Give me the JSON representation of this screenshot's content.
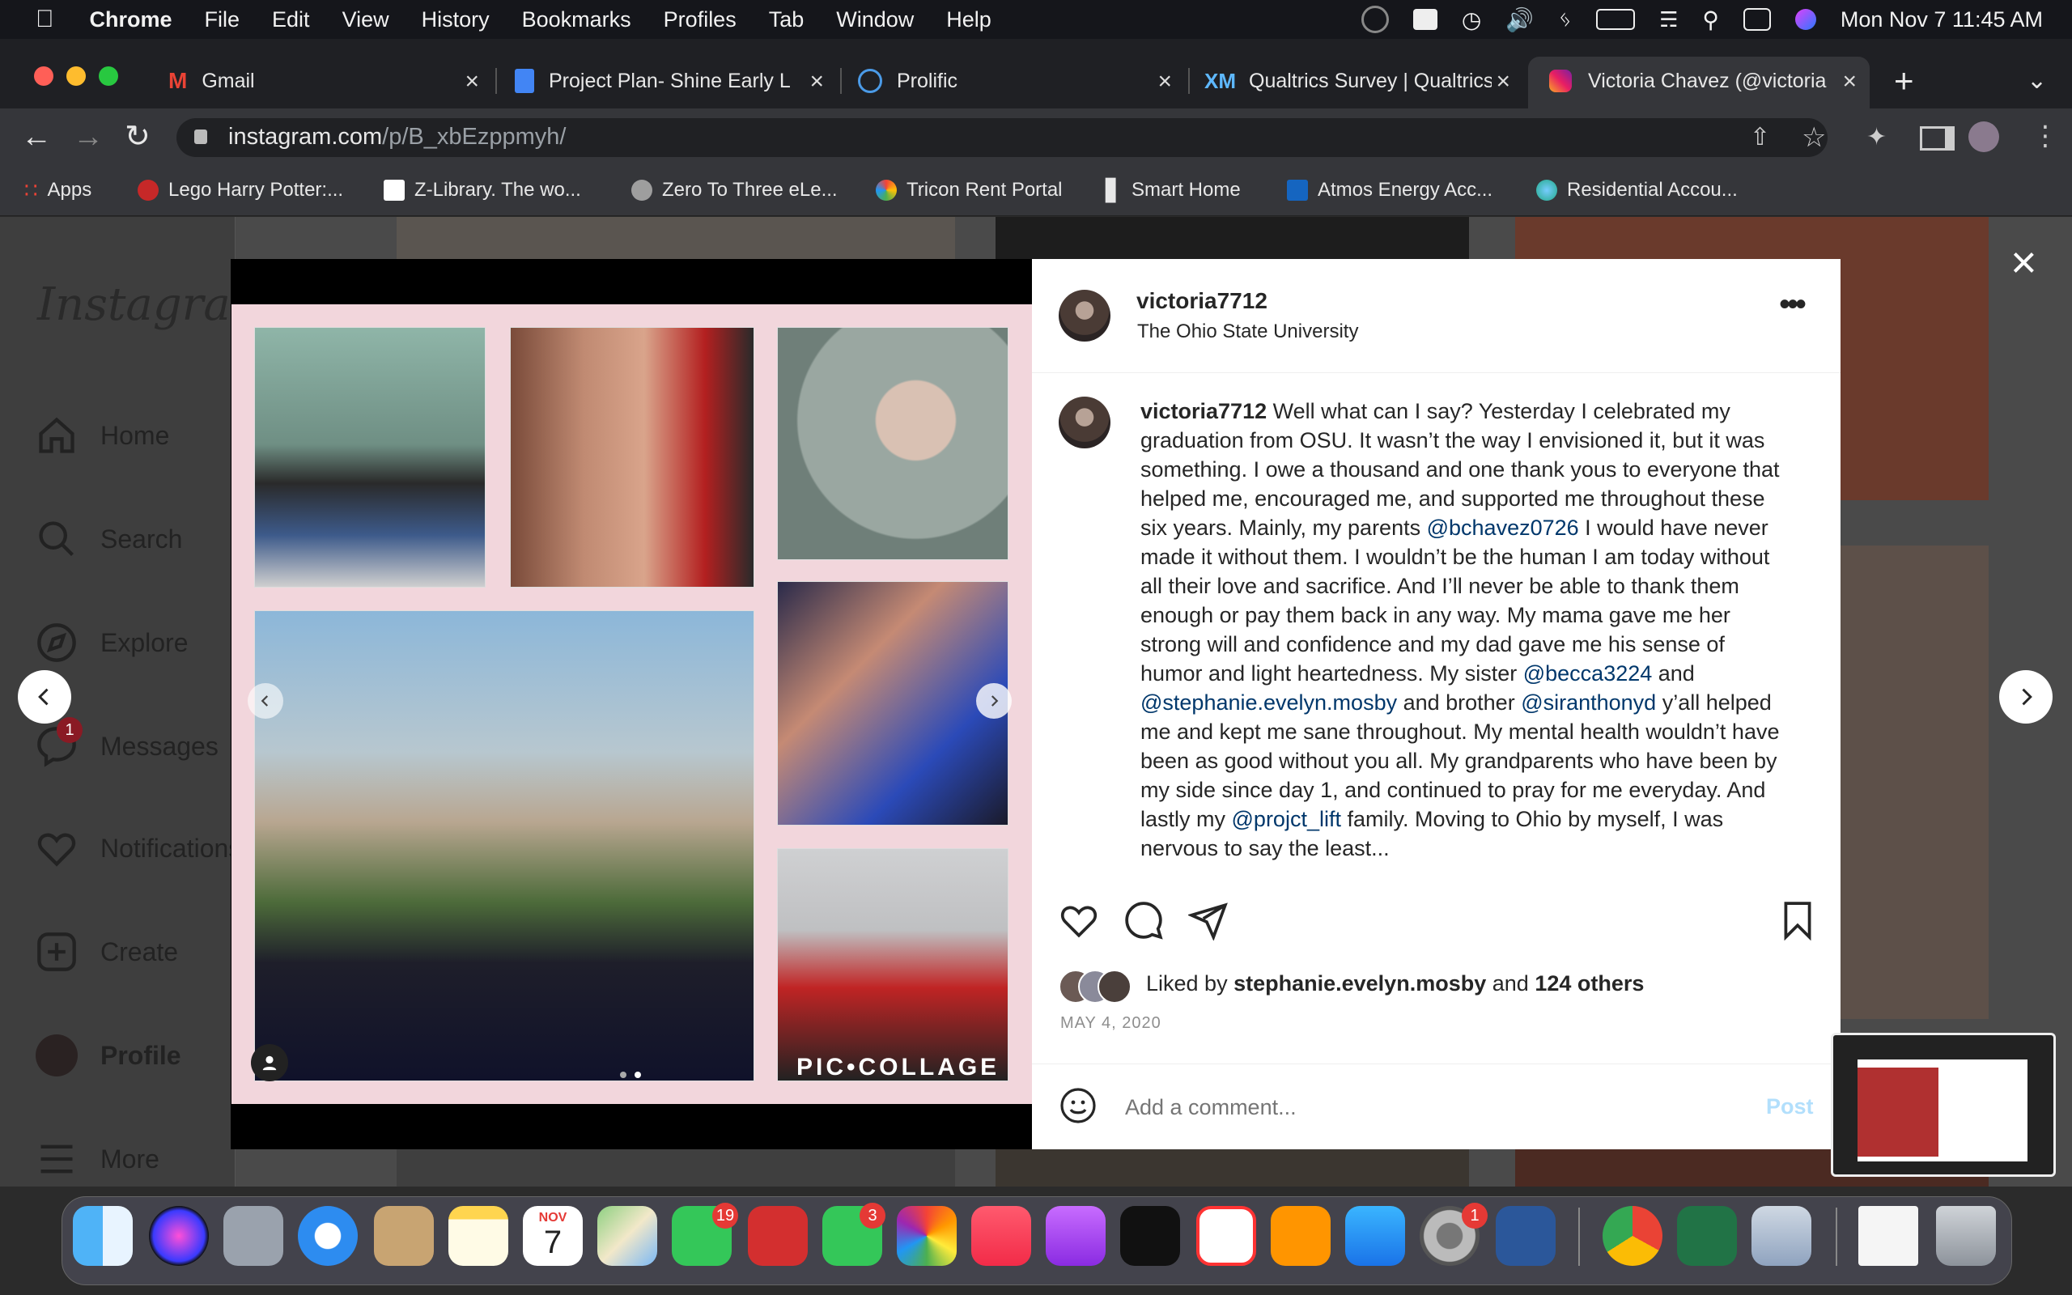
{
  "menubar": {
    "app": "Chrome",
    "items": [
      "File",
      "Edit",
      "View",
      "History",
      "Bookmarks",
      "Profiles",
      "Tab",
      "Window",
      "Help"
    ],
    "clock": "Mon Nov 7  11:45 AM"
  },
  "tabs": [
    {
      "title": "Gmail",
      "icon": "gmail-icon"
    },
    {
      "title": "Project Plan- Shine Early L",
      "icon": "docs-icon"
    },
    {
      "title": "Prolific",
      "icon": "prolific-icon"
    },
    {
      "title": "Qualtrics Survey | Qualtrics",
      "icon": "qualtrics-icon"
    },
    {
      "title": "Victoria Chavez (@victoria",
      "icon": "instagram-icon"
    }
  ],
  "address": {
    "host": "instagram.com",
    "path": "/p/B_xbEzppmyh/"
  },
  "bookmarks": [
    "Apps",
    "Lego Harry Potter:...",
    "Z-Library. The wo...",
    "Zero To Three eLe...",
    "Tricon Rent Portal",
    "Smart Home",
    "Atmos Energy Acc...",
    "Residential Accou..."
  ],
  "sidebar": {
    "logo": "Instagram",
    "items": [
      {
        "label": "Home",
        "icon": "home-icon"
      },
      {
        "label": "Search",
        "icon": "search-icon"
      },
      {
        "label": "Explore",
        "icon": "compass-icon"
      },
      {
        "label": "Messages",
        "icon": "messenger-icon",
        "badge": "1"
      },
      {
        "label": "Notifications",
        "icon": "heart-icon"
      },
      {
        "label": "Create",
        "icon": "plus-square-icon"
      },
      {
        "label": "Profile",
        "icon": "avatar"
      },
      {
        "label": "More",
        "icon": "menu-icon"
      }
    ]
  },
  "post": {
    "username": "victoria7712",
    "location": "The Ohio State University",
    "collage_watermark": "PIC•COLLAGE",
    "caption": [
      {
        "t": "Well what can I say? Yesterday I celebrated my graduation from OSU. It wasn’t the way I envisioned it, but it was something. I owe a thousand and one thank yous to everyone that helped me, encouraged me, and supported me throughout these six years. Mainly, my parents "
      },
      {
        "m": "@bchavez0726"
      },
      {
        "t": " I would have never made it without them. I wouldn’t be the human I am today without all their love and sacrifice. And I’ll never be able to thank them enough or pay them back in any way. My mama gave me her strong will and confidence and my dad gave me his sense of humor and light heartedness. My sister "
      },
      {
        "m": "@becca3224"
      },
      {
        "t": " and "
      },
      {
        "m": "@stephanie.evelyn.mosby"
      },
      {
        "t": " and brother "
      },
      {
        "m": "@siranthonyd"
      },
      {
        "t": " y’all helped me and kept me sane throughout. My mental health wouldn’t have been as good without you all. My grandparents who have been by my side since day 1, and continued to pray for me everyday. And lastly my "
      },
      {
        "m": "@projct_lift"
      },
      {
        "t": " family. Moving to Ohio by myself, I was nervous to say the least..."
      }
    ],
    "liked_by_prefix": "Liked by",
    "liked_by_user": "stephanie.evelyn.mosby",
    "liked_by_and": "and",
    "liked_by_others": "124 others",
    "date": "MAY 4, 2020",
    "comment_placeholder": "Add a comment...",
    "post_button": "Post"
  },
  "dock": {
    "apps": [
      "Finder",
      "Siri",
      "Launchpad",
      "Safari",
      "Contacts",
      "Notes",
      "Calendar",
      "Maps",
      "Messages",
      "Photo Booth",
      "FaceTime",
      "Photos",
      "Music",
      "Podcasts",
      "TV",
      "News",
      "Books",
      "App Store",
      "System Preferences",
      "Word",
      "Chrome",
      "Excel",
      "Preview",
      "PDF",
      "Trash"
    ],
    "calendar_month": "NOV",
    "calendar_day": "7",
    "messages_badge": "19",
    "facetime_badge": "3",
    "settings_badge": "1"
  },
  "colors": {
    "accent": "#0095f6",
    "mention": "#00376b",
    "post_disabled": "#b2dffc"
  }
}
